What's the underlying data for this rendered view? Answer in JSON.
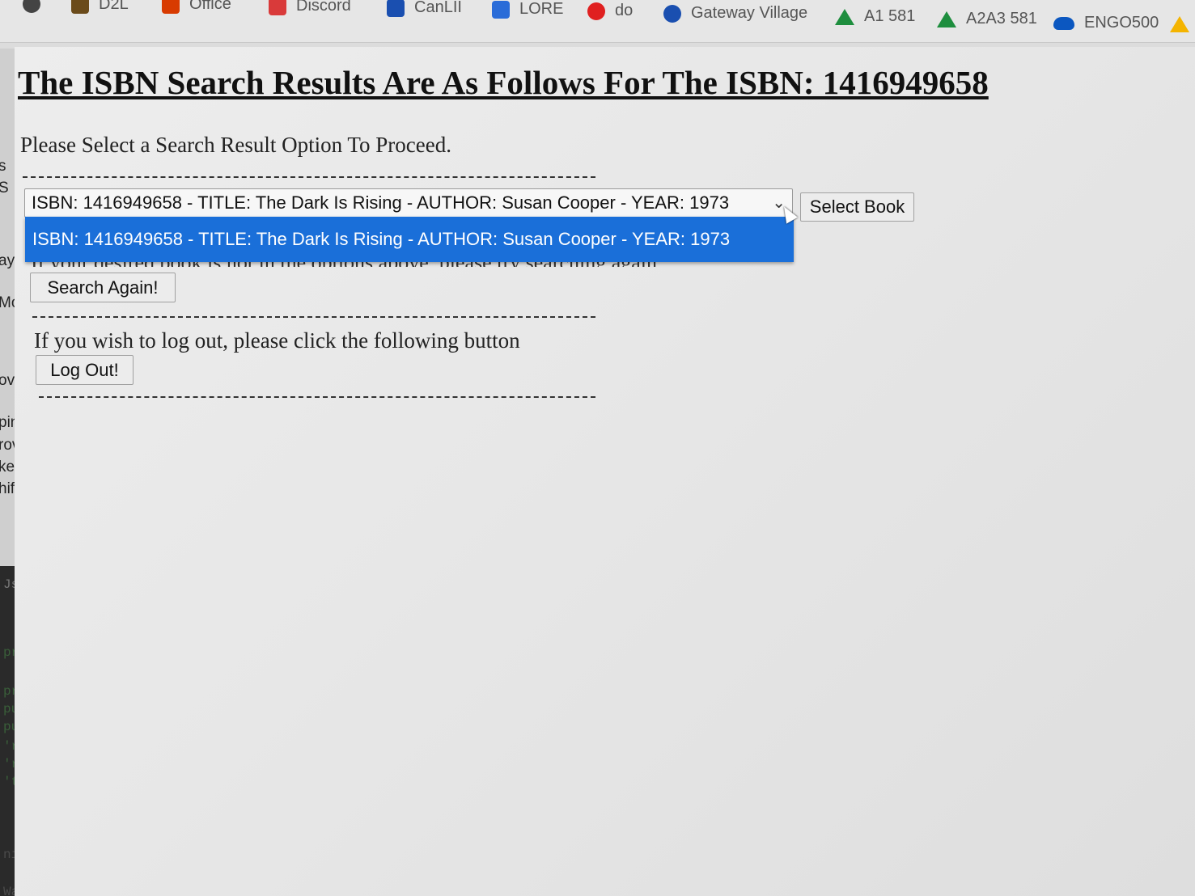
{
  "bookmarks": [
    {
      "label": "D2L",
      "icon": "d2l-icon",
      "color": "#6b4b1a"
    },
    {
      "label": "Office",
      "icon": "office-icon",
      "color": "#d83b01"
    },
    {
      "label": "Discord",
      "icon": "discord-icon",
      "color": "#d93a3a"
    },
    {
      "label": "CanLII",
      "icon": "canlii-icon",
      "color": "#1a4fb0"
    },
    {
      "label": "LORE",
      "icon": "docs-icon",
      "color": "#2a6cd8"
    },
    {
      "label": "do",
      "icon": "cbc-icon",
      "color": "#e02020"
    },
    {
      "label": "Gateway Village",
      "icon": "gateway-icon",
      "color": "#1a4fb0"
    },
    {
      "label": "A1 581",
      "icon": "drive-icon",
      "color": "#1e8e3e"
    },
    {
      "label": "A2A3 581",
      "icon": "drive-icon",
      "color": "#1e8e3e"
    },
    {
      "label": "ENGO500",
      "icon": "onedrive-icon",
      "color": "#0b57c0"
    }
  ],
  "page": {
    "title": "The ISBN Search Results Are As Follows For The ISBN: 1416949658",
    "prompt": "Please Select a Search Result Option To Proceed.",
    "dashes": "--------------------------------------------------------------------------------------",
    "select": {
      "value": "ISBN: 1416949658 - TITLE: The Dark Is Rising - AUTHOR: Susan Cooper - YEAR: 1973",
      "options": [
        "ISBN: 1416949658 - TITLE: The Dark Is Rising - AUTHOR: Susan Cooper - YEAR: 1973"
      ],
      "highlight_color": "#1a6fd9"
    },
    "select_button": "Select Book",
    "not_found_text": "If your desired book is not in the options above, please try searching again.",
    "search_again_button": "Search Again!",
    "logout_text": "If you wish to log out, please click the following button",
    "logout_button": "Log Out!"
  },
  "background": {
    "left_strip_fragments": [
      "s",
      "S",
      "ay",
      "Mo",
      "ov",
      "ping",
      "rove",
      "ketc",
      "hift"
    ],
    "code_fragments": [
      "Js",
      "prev",
      "print",
      "publ",
      "publ",
      "'rati",
      "'read",
      "'titl",
      "nitiali",
      "Watch"
    ]
  }
}
